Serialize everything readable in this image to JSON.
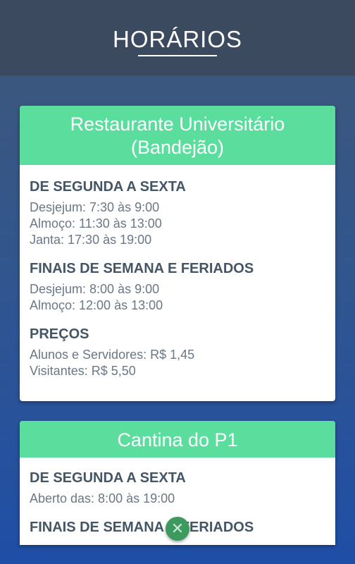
{
  "header": {
    "title": "HORÁRIOS"
  },
  "cards": [
    {
      "title_line1": "Restaurante Universitário",
      "title_line2": "(Bandejão)",
      "sections": [
        {
          "title": "DE SEGUNDA A SEXTA",
          "lines": [
            "Desjejum: 7:30 às 9:00",
            "Almoço: 11:30 às 13:00",
            "Janta: 17:30 às 19:00"
          ]
        },
        {
          "title": "FINAIS DE SEMANA E FERIADOS",
          "lines": [
            "Desjejum: 8:00 às 9:00",
            "Almoço: 12:00 às 13:00"
          ]
        },
        {
          "title": "PREÇOS",
          "lines": [
            "Alunos e Servidores: R$ 1,45",
            "Visitantes: R$ 5,50"
          ]
        }
      ]
    },
    {
      "title_line1": "Cantina do P1",
      "sections": [
        {
          "title": "DE SEGUNDA A SEXTA",
          "lines": [
            "Aberto das: 8:00 às 19:00"
          ]
        },
        {
          "title": "FINAIS DE SEMANA E FERIADOS",
          "lines": []
        }
      ]
    }
  ],
  "fab": {
    "icon": "close-icon",
    "glyph": "✕"
  }
}
